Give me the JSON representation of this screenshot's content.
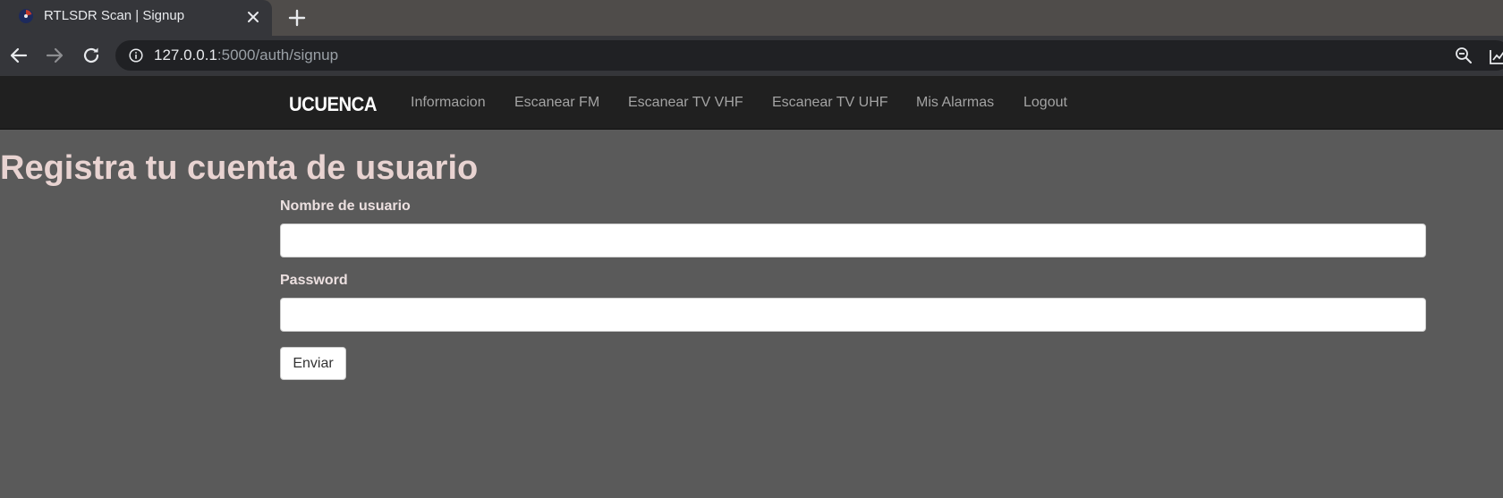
{
  "browser": {
    "tab": {
      "title": "RTLSDR Scan | Signup",
      "favicon": "radar-icon"
    },
    "url": {
      "host": "127.0.0.1",
      "path": ":5000/auth/signup"
    },
    "icons": {
      "back": "back-arrow-icon",
      "forward": "forward-arrow-icon",
      "reload": "reload-icon",
      "info": "info-icon",
      "zoom": "zoom-out-icon",
      "extension": "chart-icon",
      "close": "close-icon",
      "new_tab": "plus-icon"
    }
  },
  "navbar": {
    "brand": "UCUENCA",
    "links": [
      "Informacion",
      "Escanear FM",
      "Escanear TV VHF",
      "Escanear TV UHF",
      "Mis Alarmas",
      "Logout"
    ]
  },
  "form": {
    "heading": "Registra tu cuenta de usuario",
    "username_label": "Nombre de usuario",
    "username_value": "",
    "password_label": "Password",
    "password_value": "",
    "submit_label": "Enviar"
  },
  "colors": {
    "page_background": "#5a5a5a",
    "navbar_background": "#202020",
    "heading_color": "#e8d3d1",
    "nav_link_color": "#a3a3a3"
  }
}
